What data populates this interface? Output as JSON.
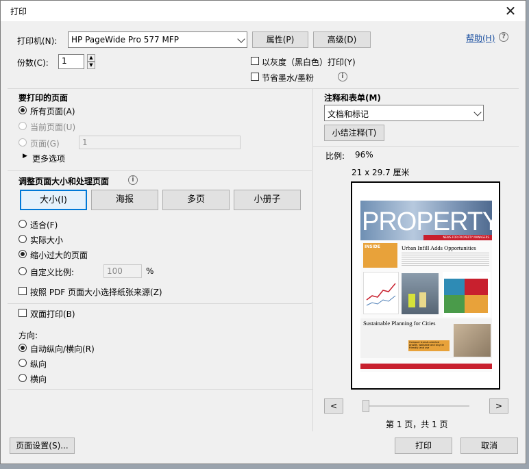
{
  "window": {
    "title": "打印",
    "close_symbol": "✕"
  },
  "printer": {
    "label": "打印机(N):",
    "selected": "HP PageWide Pro 577 MFP",
    "properties_button": "属性(P)",
    "advanced_button": "高级(D)",
    "help_link": "帮助(H)",
    "copies_label": "份数(C):",
    "copies_value": "1",
    "grayscale_label": "以灰度（黑白色）打印(Y)",
    "save_ink_label": "节省墨水/墨粉"
  },
  "pages": {
    "heading": "要打印的页面",
    "all_pages": "所有页面(A)",
    "current_page": "当前页面(U)",
    "pages_option": "页面(G)",
    "pages_value": "1",
    "more_options": "更多选项"
  },
  "sizing": {
    "heading": "调整页面大小和处理页面",
    "tabs": [
      "大小(I)",
      "海报",
      "多页",
      "小册子"
    ],
    "fit": "适合(F)",
    "actual_size": "实际大小",
    "shrink_oversized": "缩小过大的页面",
    "custom_scale": "自定义比例:",
    "custom_scale_value": "100",
    "percent": "%",
    "choose_paper_source": "按照 PDF 页面大小选择纸张来源(Z)"
  },
  "duplex": {
    "label": "双面打印(B)",
    "orientation_label": "方向:",
    "auto": "自动纵向/横向(R)",
    "portrait": "纵向",
    "landscape": "横向"
  },
  "comments": {
    "heading": "注释和表单(M)",
    "selected": "文档和标记",
    "summarize_button": "小结注释(T)"
  },
  "preview": {
    "scale_label": "比例:",
    "scale_value": "96%",
    "paper_size": "21 x 29.7 厘米",
    "page_indicator": "第 1 页，共 1 页",
    "prev": "<",
    "next": ">",
    "doc": {
      "masthead": "PROPERTY",
      "tagline": "NEWS FOR PROPERTY MANAGERS",
      "inside": "INSIDE",
      "headline1": "Urban Infill Adds Opportunities",
      "headline2": "Sustainable Planning for Cities",
      "callout": "Compact transit-oriented growth, walkable and bicycle friendly land use"
    }
  },
  "footer": {
    "page_setup": "页面设置(S)...",
    "print": "打印",
    "cancel": "取消"
  },
  "colors": {
    "accent": "#0078d7",
    "link": "#1a4fa0",
    "red": "#c8202e",
    "orange": "#e8a23a"
  }
}
